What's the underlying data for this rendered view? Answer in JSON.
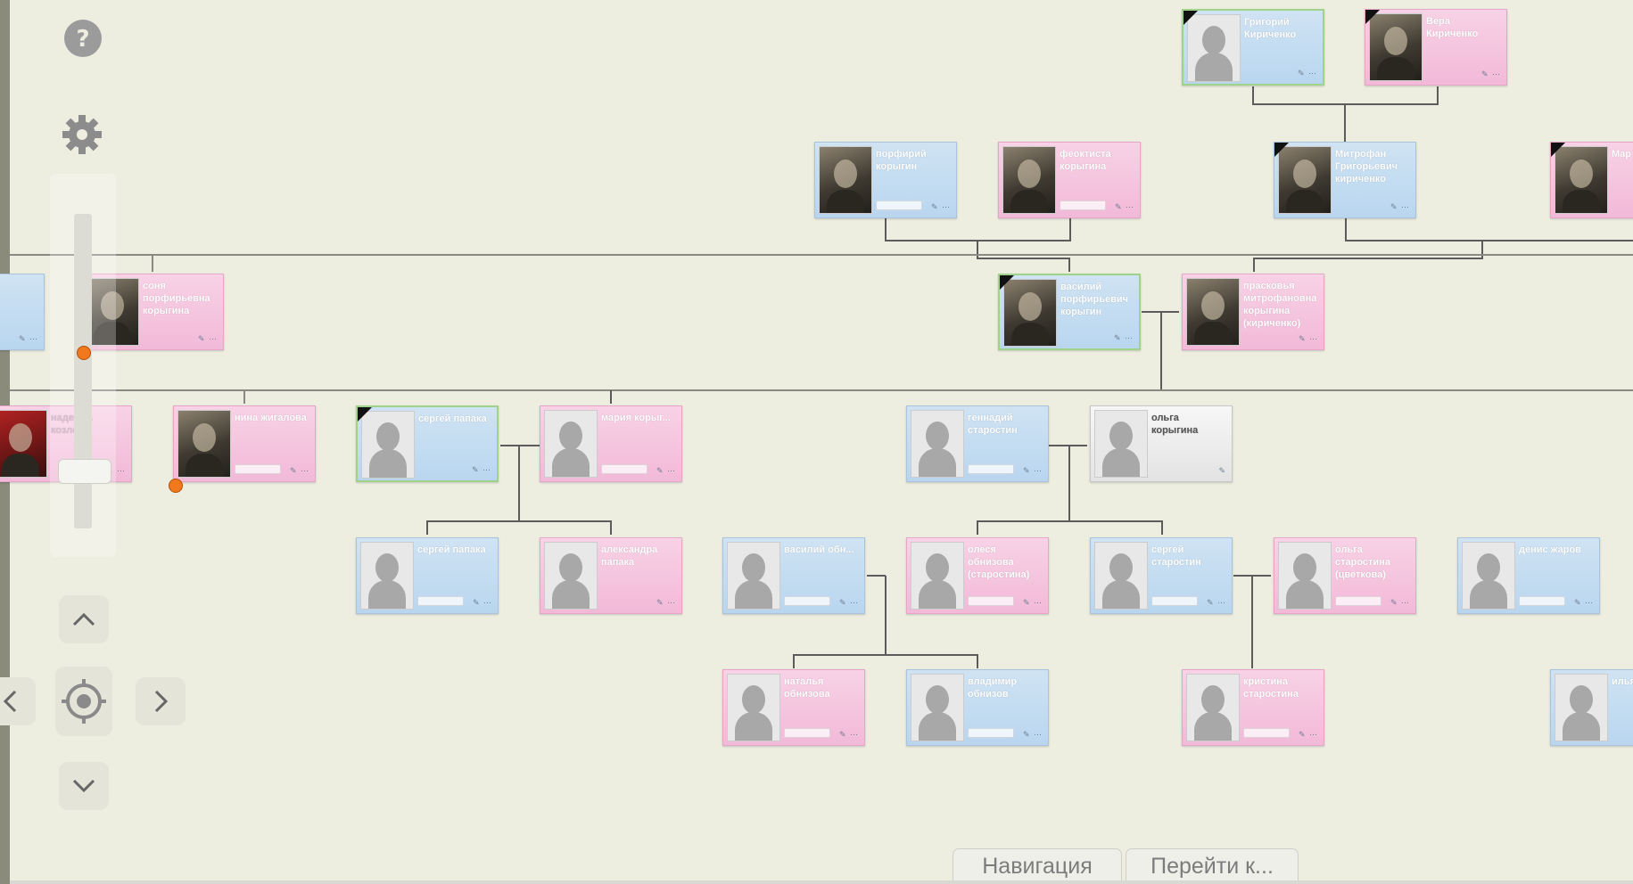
{
  "navigation_tabs": {
    "navigation": "Навигация",
    "goto": "Перейти к..."
  },
  "controls": {
    "help_icon": "help-circle-icon",
    "settings_icon": "gear-icon",
    "up_icon": "chevron-up-icon",
    "down_icon": "chevron-down-icon",
    "left_icon": "chevron-left-icon",
    "right_icon": "chevron-right-icon",
    "center_icon": "locate-icon"
  },
  "people": [
    {
      "name": "Григорий Кириченко",
      "gender": "male"
    },
    {
      "name": "Вера Кириченко",
      "gender": "female"
    },
    {
      "name": "порфирий корыгин",
      "gender": "male"
    },
    {
      "name": "феоктиста корыгина",
      "gender": "female"
    },
    {
      "name": "Митрофан Григорьевич кириченко",
      "gender": "male"
    },
    {
      "name": "Map Иви кири",
      "gender": "female"
    },
    {
      "name": "соня порфирьевна корыгина",
      "gender": "female"
    },
    {
      "name": "василий порфирьевич корыгин",
      "gender": "male"
    },
    {
      "name": "прасковья митрофановна корыгина (кириченко)",
      "gender": "female"
    },
    {
      "name": "надежда козлова",
      "gender": "female"
    },
    {
      "name": "нина жигалова",
      "gender": "female"
    },
    {
      "name": "сергей папака",
      "gender": "male"
    },
    {
      "name": "мария корыг...",
      "gender": "female"
    },
    {
      "name": "геннадий старостин",
      "gender": "male"
    },
    {
      "name": "ольга корыгина",
      "gender": "unknown"
    },
    {
      "name": "сергей папака",
      "gender": "male"
    },
    {
      "name": "александра папака",
      "gender": "female"
    },
    {
      "name": "василий обн...",
      "gender": "male"
    },
    {
      "name": "олеся обнизова (старостина)",
      "gender": "female"
    },
    {
      "name": "сергей старостин",
      "gender": "male"
    },
    {
      "name": "ольга старостина (цветкова)",
      "gender": "female"
    },
    {
      "name": "денис жаров",
      "gender": "male"
    },
    {
      "name": "наталья обнизова",
      "gender": "female"
    },
    {
      "name": "владимир обнизов",
      "gender": "male"
    },
    {
      "name": "кристина старостина",
      "gender": "female"
    },
    {
      "name": "илья",
      "gender": "male"
    }
  ],
  "colors": {
    "background": "#edede0",
    "male_card": "#b9d6ef",
    "female_card": "#f2b9d8",
    "line": "#555555"
  }
}
